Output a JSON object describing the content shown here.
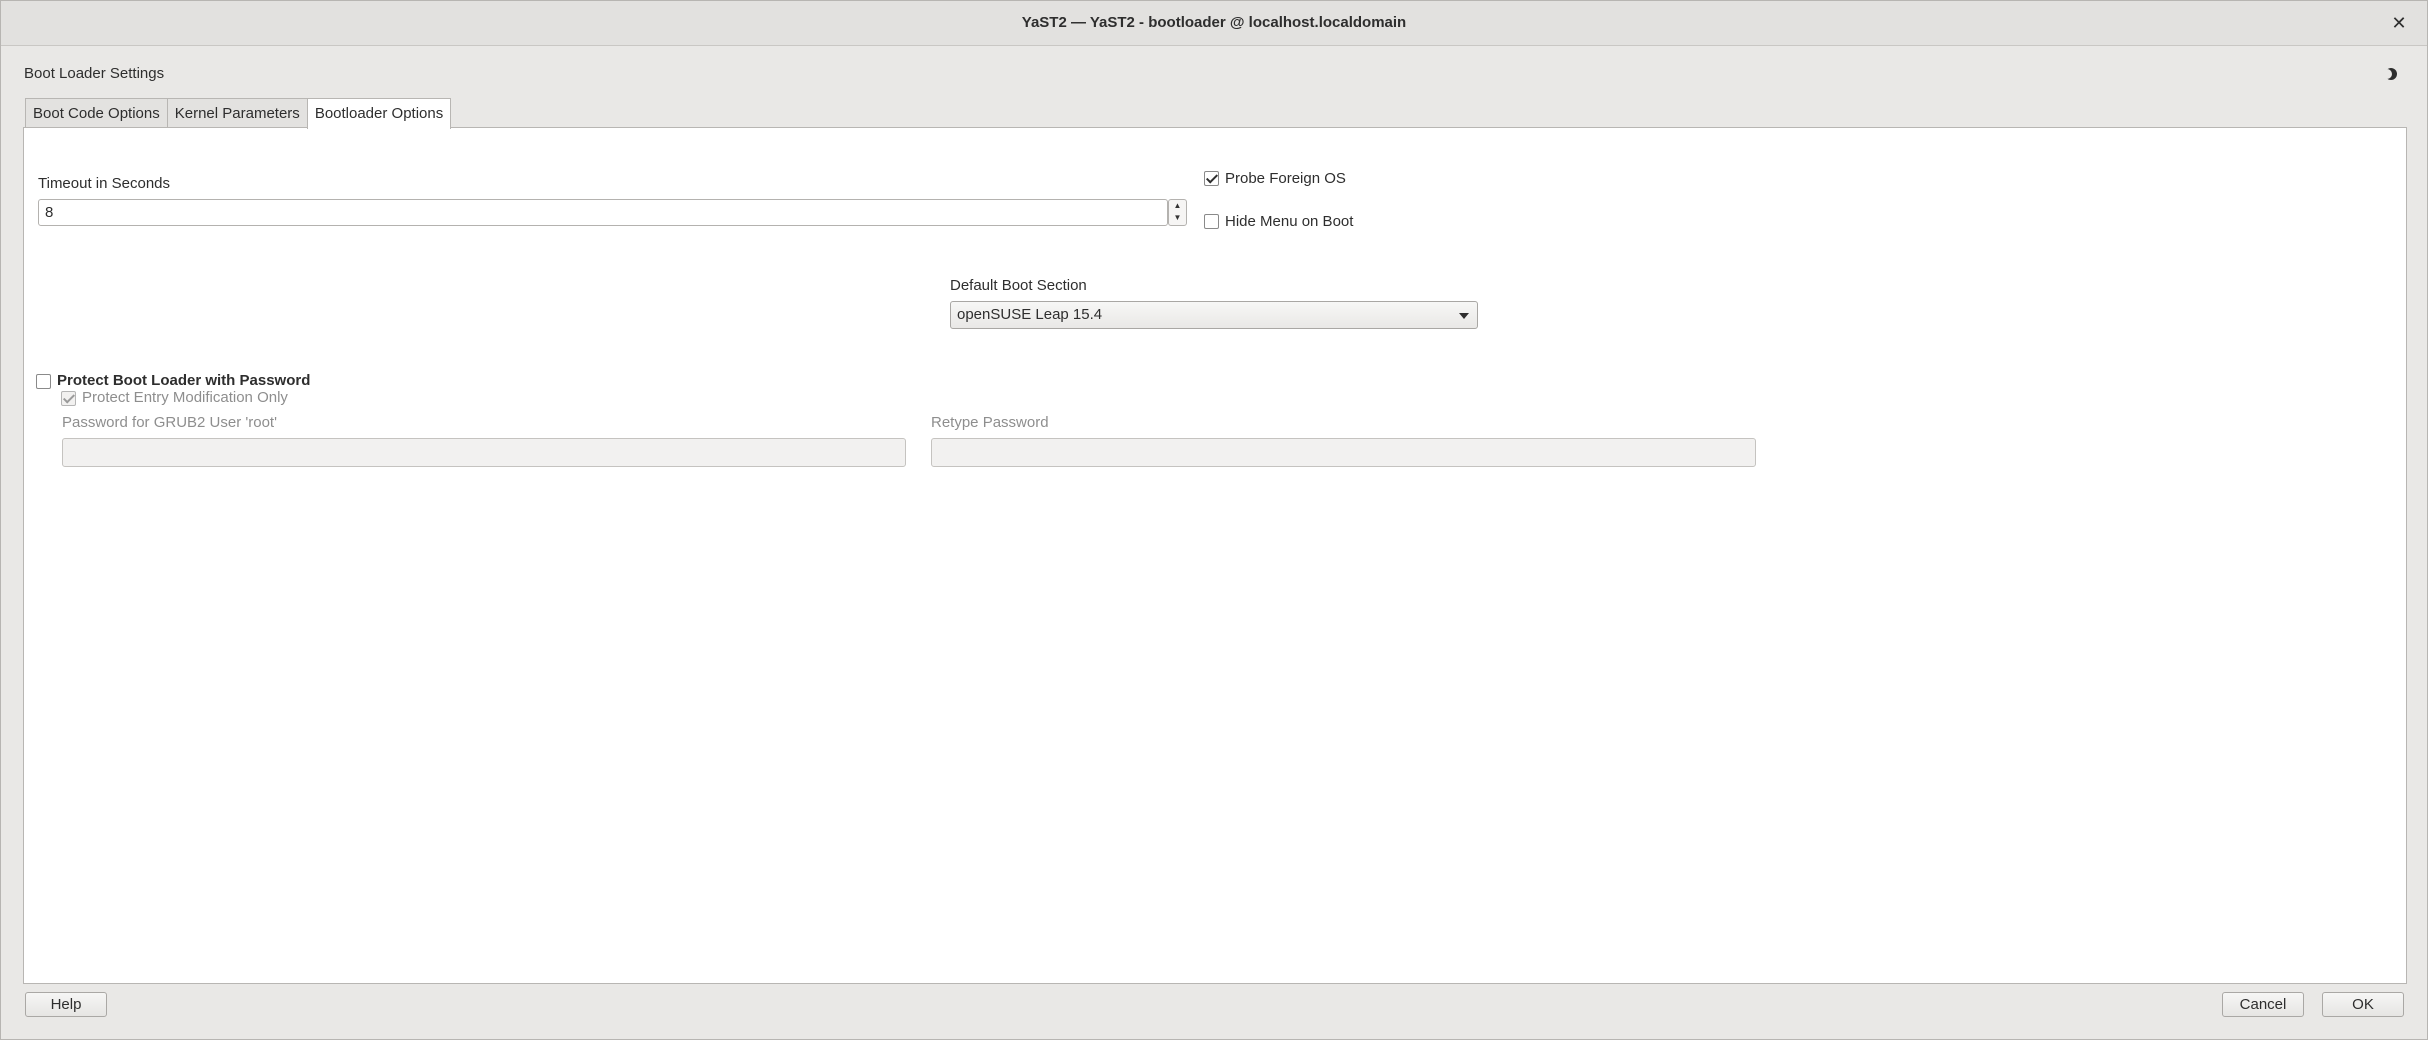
{
  "window": {
    "title": "YaST2 — YaST2 - bootloader @ localhost.localdomain",
    "close_label": "✕"
  },
  "dialog": {
    "heading": "Boot Loader Settings"
  },
  "tabs": [
    {
      "label": "Boot Code Options"
    },
    {
      "label": "Kernel Parameters"
    },
    {
      "label": "Bootloader Options",
      "active": true
    }
  ],
  "options": {
    "timeout": {
      "label": "Timeout in Seconds",
      "value": "8"
    },
    "probe_foreign_os": {
      "label": "Probe Foreign OS",
      "checked": true
    },
    "hide_menu_on_boot": {
      "label": "Hide Menu on Boot",
      "checked": false
    },
    "default_boot_section": {
      "label": "Default Boot Section",
      "value": "openSUSE Leap 15.4"
    }
  },
  "password": {
    "protect_label": "Protect Boot Loader with Password",
    "protect_checked": false,
    "entry_only_label": "Protect Entry Modification Only",
    "entry_only_checked": true,
    "password_label": "Password for GRUB2 User 'root'",
    "password_value": "",
    "retype_label": "Retype Password",
    "retype_value": ""
  },
  "footer": {
    "help": "Help",
    "cancel": "Cancel",
    "ok": "OK"
  },
  "icons": {
    "theme": "half-moon-icon",
    "spin_up": "spin-up-icon",
    "spin_down": "spin-down-icon",
    "dropdown": "dropdown-arrow-icon"
  }
}
